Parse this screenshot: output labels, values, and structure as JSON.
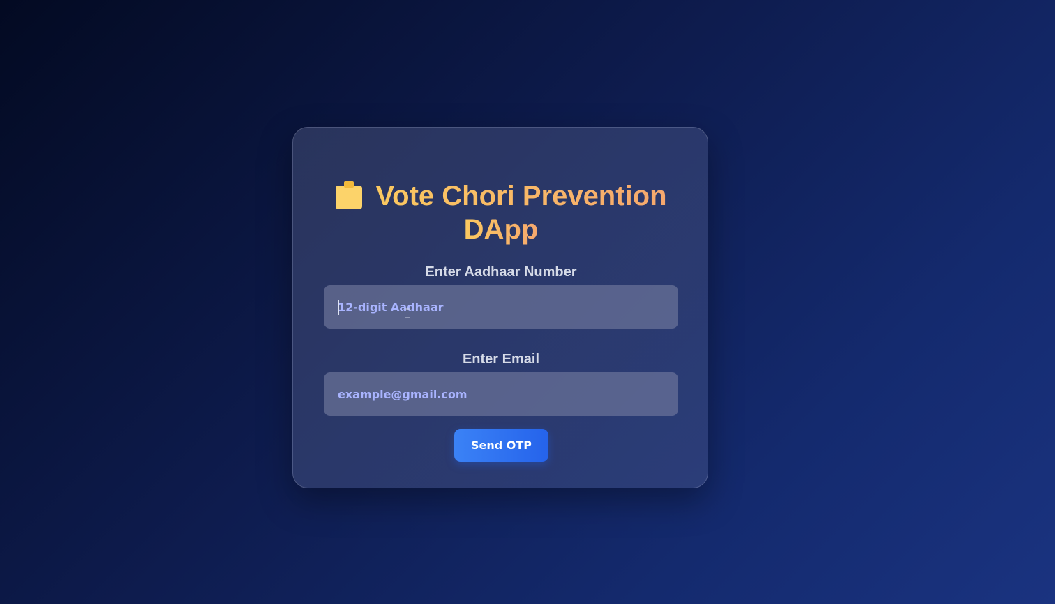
{
  "app": {
    "title_line1": "Vote Chori Prevention",
    "title_line2": "DApp",
    "title_icon": "clipboard-icon"
  },
  "form": {
    "aadhaar": {
      "label": "Enter Aadhaar Number",
      "value": "",
      "placeholder": "12-digit Aadhaar"
    },
    "email": {
      "label": "Enter Email",
      "value": "",
      "placeholder": "example@gmail.com"
    },
    "submit_label": "Send OTP"
  },
  "colors": {
    "title_gradient_start": "#fbc960",
    "title_gradient_end": "#f6a86e",
    "placeholder": "#a9b4ff",
    "button_start": "#3b82f6",
    "button_end": "#2563eb"
  }
}
